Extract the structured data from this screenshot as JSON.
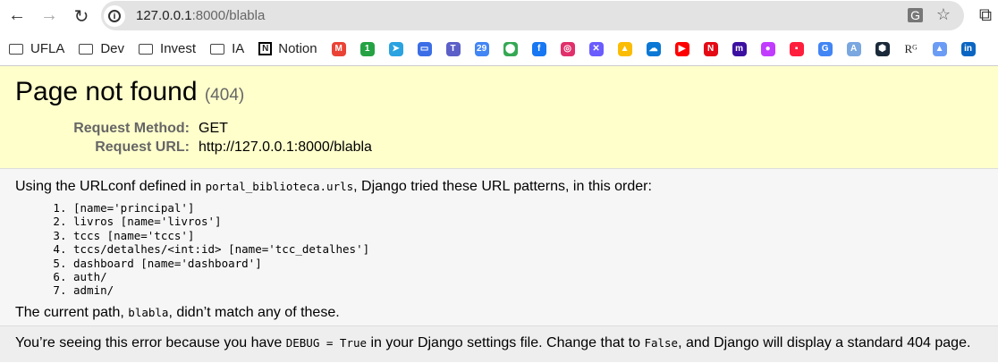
{
  "browser": {
    "url_host": "127.0.0.1",
    "url_rest": ":8000/blabla",
    "bookmarks": [
      {
        "label": "UFLA",
        "icon": "folder-icon"
      },
      {
        "label": "Dev",
        "icon": "folder-icon"
      },
      {
        "label": "Invest",
        "icon": "folder-icon"
      },
      {
        "label": "IA",
        "icon": "folder-icon"
      },
      {
        "label": "Notion",
        "icon": "notion-icon"
      }
    ],
    "favicons": [
      {
        "name": "gmail-icon",
        "color": "#ea4335",
        "glyph": "M"
      },
      {
        "name": "whatsapp-icon",
        "color": "#25a244",
        "glyph": "1"
      },
      {
        "name": "telegram-icon",
        "color": "#2aa3e0",
        "glyph": "➤"
      },
      {
        "name": "chat-icon",
        "color": "#3b6ee6",
        "glyph": "▭"
      },
      {
        "name": "teams-icon",
        "color": "#5b5fc7",
        "glyph": "T"
      },
      {
        "name": "calendar-icon",
        "color": "#4285f4",
        "glyph": "29"
      },
      {
        "name": "maps-icon",
        "color": "#34a853",
        "glyph": "⬤"
      },
      {
        "name": "facebook-icon",
        "color": "#1877f2",
        "glyph": "f"
      },
      {
        "name": "instagram-icon",
        "color": "#e1306c",
        "glyph": "◎"
      },
      {
        "name": "bank-icon",
        "color": "#6a5cff",
        "glyph": "✕"
      },
      {
        "name": "drive-icon",
        "color": "#fbbc04",
        "glyph": "▲"
      },
      {
        "name": "onedrive-icon",
        "color": "#0a78d4",
        "glyph": "☁"
      },
      {
        "name": "youtube-icon",
        "color": "#ff0000",
        "glyph": "▶"
      },
      {
        "name": "netflix-icon",
        "color": "#e50914",
        "glyph": "N"
      },
      {
        "name": "m-icon",
        "color": "#3c10a0",
        "glyph": "m"
      },
      {
        "name": "color-wheel-icon",
        "color": "#c13cff",
        "glyph": "●"
      },
      {
        "name": "red-app-icon",
        "color": "#ff1e3c",
        "glyph": "▪"
      },
      {
        "name": "google-translate-icon",
        "color": "#4285f4",
        "glyph": "G"
      },
      {
        "name": "translate-icon",
        "color": "#7ba7e0",
        "glyph": "A"
      },
      {
        "name": "hexagon-app-icon",
        "color": "#1b2a3a",
        "glyph": "⬢"
      },
      {
        "name": "researchgate-icon",
        "color": "#ffffff",
        "glyph": "Rᴳ"
      },
      {
        "name": "graduation-cap-icon",
        "color": "#6b9cf5",
        "glyph": "▲"
      },
      {
        "name": "linkedin-icon",
        "color": "#0a66c2",
        "glyph": "in"
      }
    ]
  },
  "summary": {
    "title": "Page not found",
    "code": "(404)",
    "method_label": "Request Method:",
    "method": "GET",
    "url_label": "Request URL:",
    "url": "http://127.0.0.1:8000/blabla"
  },
  "info": {
    "intro_pre": "Using the URLconf defined in ",
    "urlconf": "portal_biblioteca.urls",
    "intro_post": ", Django tried these URL patterns, in this order:",
    "patterns": [
      "[name='principal']",
      "livros [name='livros']",
      "tccs [name='tccs']",
      "tccs/detalhes/<int:id> [name='tcc_detalhes']",
      "dashboard [name='dashboard']",
      "auth/",
      "admin/"
    ],
    "current_pre": "The current path, ",
    "path": "blabla",
    "current_post": ", didn’t match any of these."
  },
  "explanation": {
    "p1": "You’re seeing this error because you have ",
    "debug": "DEBUG = True",
    "p2": " in your Django settings file. Change that to ",
    "false": "False",
    "p3": ", and Django will display a standard 404 page."
  }
}
